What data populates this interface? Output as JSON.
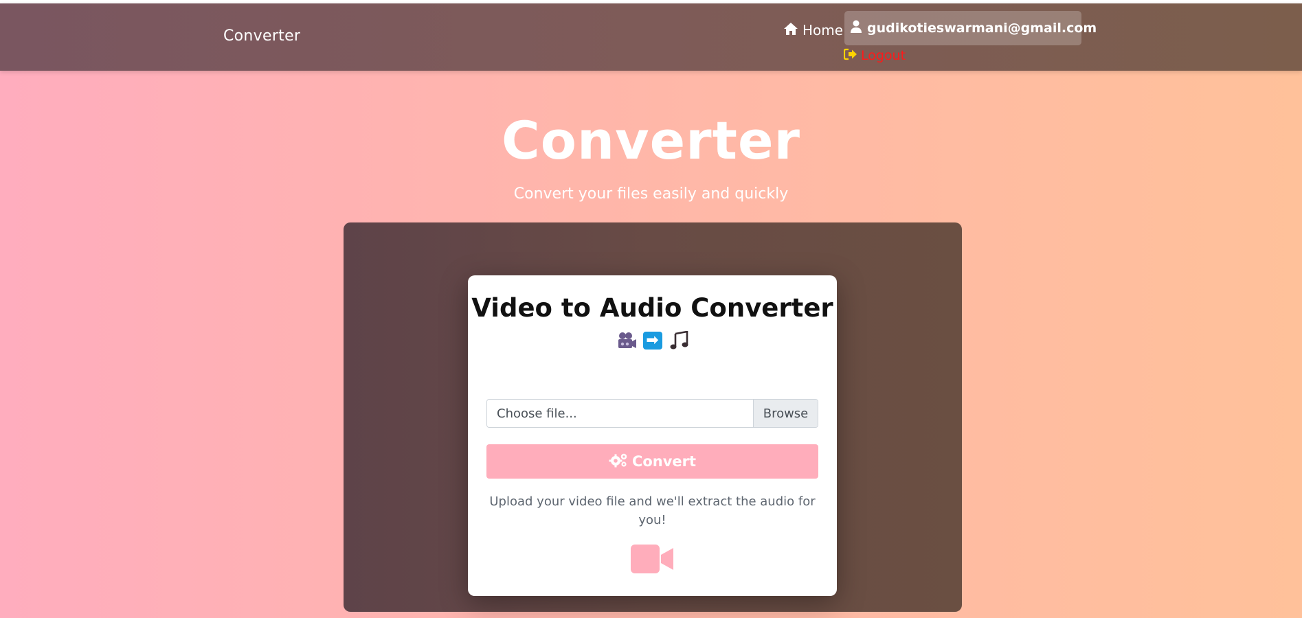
{
  "navbar": {
    "brand": "Converter",
    "home_label": "Home",
    "home_icon": "home-icon",
    "user_email": "gudikotieswarmani@gmail.com",
    "user_icon": "user-icon",
    "logout_label": "Logout",
    "logout_icon": "sign-out-icon"
  },
  "hero": {
    "title": "Converter",
    "subtitle": "Convert your files easily and quickly"
  },
  "card": {
    "title": "Video to Audio Converter",
    "emojis": [
      "movie-camera-icon",
      "right-arrow-icon",
      "musical-notes-icon"
    ],
    "arrow_glyph": "➡",
    "file_input": {
      "placeholder": "Choose file...",
      "browse_label": "Browse"
    },
    "convert_label": "Convert",
    "convert_icon": "cogs-icon",
    "help_text": "Upload your video file and we'll extract the audio for you!",
    "footer_icon": "video-camera-icon"
  },
  "colors": {
    "accent_pink": "#ffadbb",
    "logout_red": "#ff1a1a",
    "logout_icon_yellow": "#ffd400",
    "arrow_blue": "#1a9be0"
  }
}
